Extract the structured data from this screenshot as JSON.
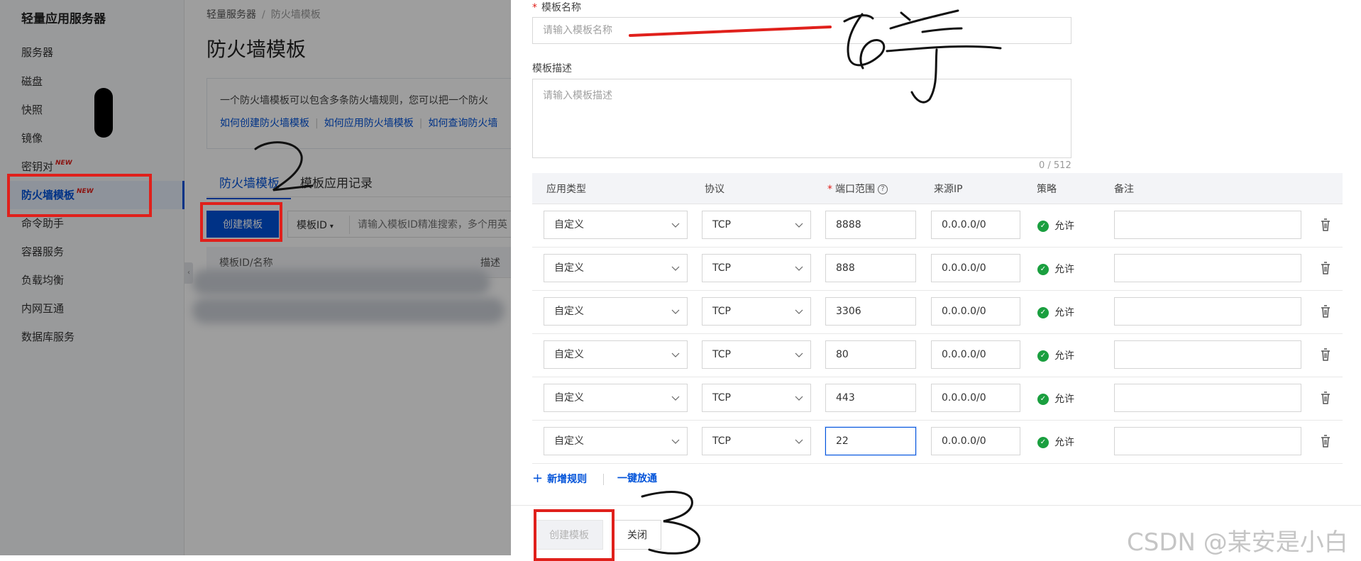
{
  "sidebar": {
    "title": "轻量应用服务器",
    "items": [
      {
        "label": "服务器"
      },
      {
        "label": "磁盘"
      },
      {
        "label": "快照"
      },
      {
        "label": "镜像"
      },
      {
        "label": "密钥对",
        "badge": "NEW"
      },
      {
        "label": "防火墙模板",
        "badge": "NEW",
        "active": true
      },
      {
        "label": "命令助手"
      },
      {
        "label": "容器服务"
      },
      {
        "label": "负载均衡"
      },
      {
        "label": "内网互通"
      },
      {
        "label": "数据库服务"
      }
    ]
  },
  "main": {
    "breadcrumb": [
      "轻量服务器",
      "防火墙模板"
    ],
    "title": "防火墙模板",
    "info_text": "一个防火墙模板可以包含多条防火墙规则，您可以把一个防火",
    "info_links": [
      "如何创建防火墙模板",
      "如何应用防火墙模板",
      "如何查询防火墙"
    ],
    "tabs": [
      "防火墙模板",
      "模板应用记录"
    ],
    "create_button": "创建模板",
    "filter_select": "模板ID",
    "filter_placeholder": "请输入模板ID精准搜索，多个用英",
    "table_headers": [
      "模板ID/名称",
      "描述"
    ]
  },
  "drawer": {
    "name_label": "模板名称",
    "name_placeholder": "请输入模板名称",
    "desc_label": "模板描述",
    "desc_placeholder": "请输入模板描述",
    "desc_counter": "0 / 512",
    "columns": {
      "app_type": "应用类型",
      "protocol": "协议",
      "port_range": "端口范围",
      "source_ip": "来源IP",
      "policy": "策略",
      "remark": "备注"
    },
    "rules": [
      {
        "app_type": "自定义",
        "protocol": "TCP",
        "port": "8888",
        "source": "0.0.0.0/0",
        "policy": "允许",
        "remark": ""
      },
      {
        "app_type": "自定义",
        "protocol": "TCP",
        "port": "888",
        "source": "0.0.0.0/0",
        "policy": "允许",
        "remark": ""
      },
      {
        "app_type": "自定义",
        "protocol": "TCP",
        "port": "3306",
        "source": "0.0.0.0/0",
        "policy": "允许",
        "remark": ""
      },
      {
        "app_type": "自定义",
        "protocol": "TCP",
        "port": "80",
        "source": "0.0.0.0/0",
        "policy": "允许",
        "remark": ""
      },
      {
        "app_type": "自定义",
        "protocol": "TCP",
        "port": "443",
        "source": "0.0.0.0/0",
        "policy": "允许",
        "remark": ""
      },
      {
        "app_type": "自定义",
        "protocol": "TCP",
        "port": "22",
        "source": "0.0.0.0/0",
        "policy": "允许",
        "remark": ""
      }
    ],
    "add_rule": "新增规则",
    "open_all": "一键放通",
    "create_button": "创建模板",
    "close_button": "关闭"
  },
  "annotations": {
    "handwriting": "名字",
    "step2": "2",
    "step3": "3",
    "color": "#e0201b"
  },
  "watermark": "CSDN @某安是小白",
  "colors": {
    "primary": "#0052d9",
    "success": "#1a9f3f",
    "danger": "#e0201b"
  }
}
